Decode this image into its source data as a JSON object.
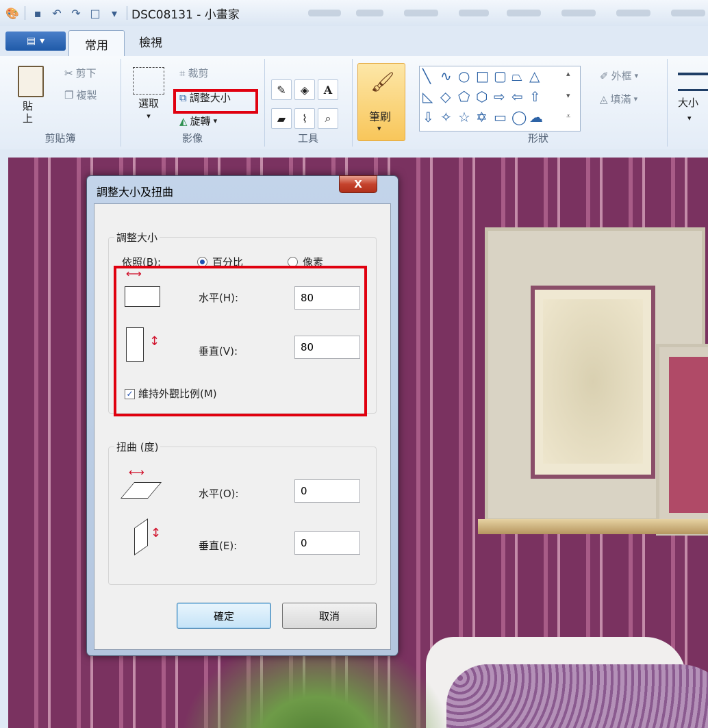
{
  "window": {
    "title": "DSC08131 - 小畫家",
    "quick_access": [
      "paint-app-icon",
      "save-icon",
      "undo-icon",
      "redo-icon",
      "new-file-icon",
      "customize-dropdown-icon"
    ]
  },
  "tabs": {
    "file_menu_icon": "paint-menu-icon",
    "home": "常用",
    "view": "檢視"
  },
  "ribbon": {
    "clipboard": {
      "label": "剪貼簿",
      "paste": "貼上",
      "cut": "剪下",
      "copy": "複製"
    },
    "image": {
      "label": "影像",
      "select": "選取",
      "crop": "裁剪",
      "resize": "調整大小",
      "rotate": "旋轉"
    },
    "tools": {
      "label": "工具"
    },
    "brush": {
      "label": "筆刷"
    },
    "shapes": {
      "label": "形狀",
      "outline": "外框",
      "fill": "填滿"
    },
    "size": {
      "label": "大小"
    }
  },
  "dialog": {
    "title": "調整大小及扭曲",
    "close_glyph": "X",
    "resize": {
      "legend": "調整大小",
      "by_label": "依照(B):",
      "percent_label": "百分比",
      "pixels_label": "像素",
      "selected_unit": "percent",
      "horizontal_label": "水平(H):",
      "horizontal_value": "80",
      "vertical_label": "垂直(V):",
      "vertical_value": "80",
      "maintain_ratio_label": "維持外觀比例(M)",
      "maintain_ratio_checked": true
    },
    "skew": {
      "legend": "扭曲 (度)",
      "horizontal_label": "水平(O):",
      "horizontal_value": "0",
      "vertical_label": "垂直(E):",
      "vertical_value": "0"
    },
    "ok": "確定",
    "cancel": "取消"
  },
  "colors": {
    "highlight": "#e0000f",
    "accent": "#1f5aa8",
    "brush_active": "#f8c65a"
  }
}
